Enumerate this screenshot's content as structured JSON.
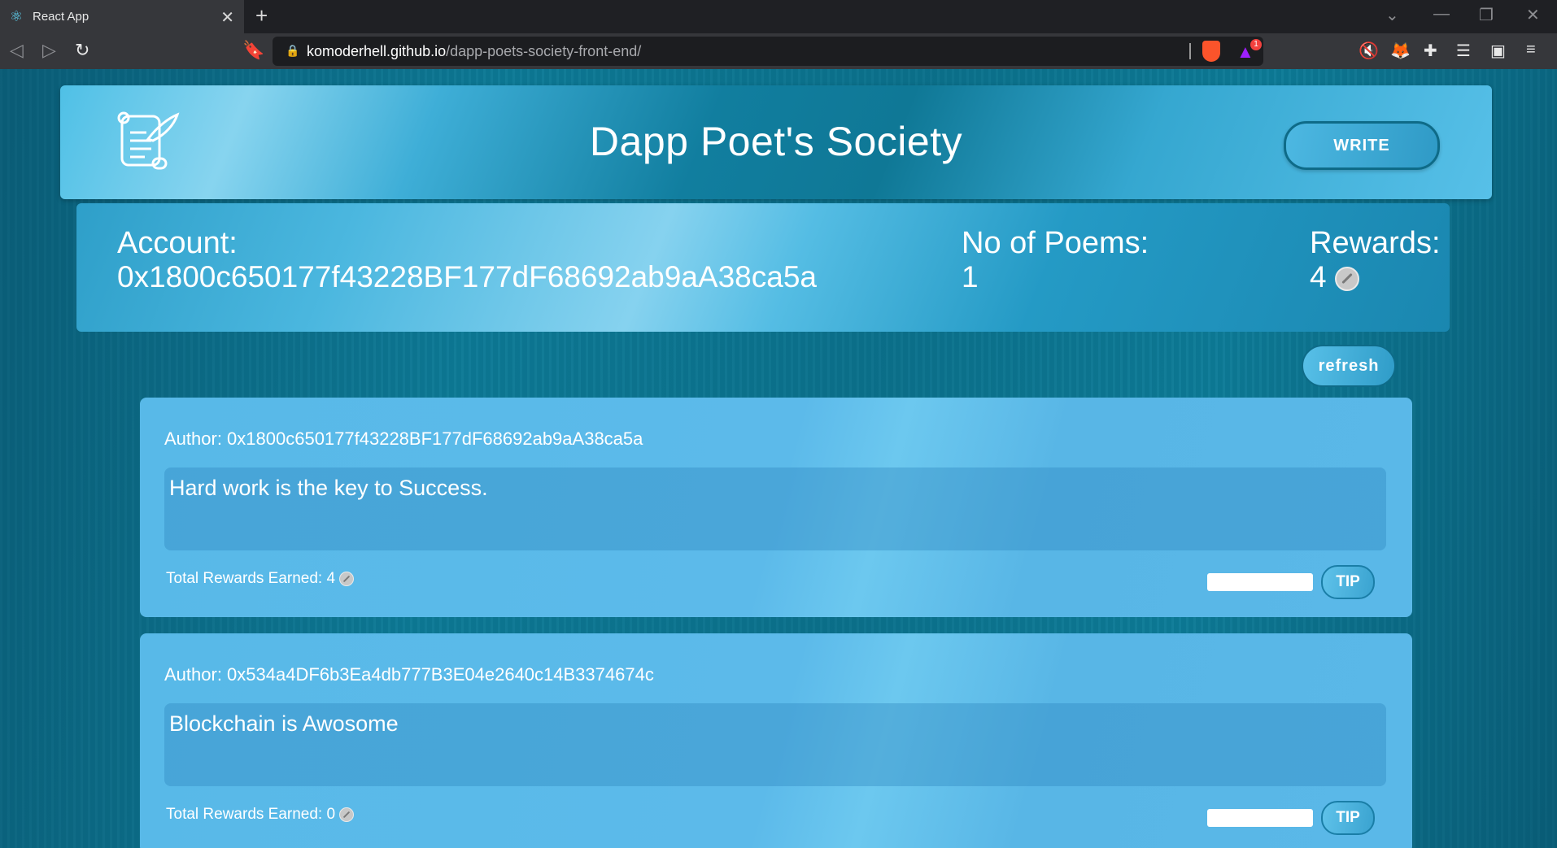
{
  "browser": {
    "tab_title": "React App",
    "tab_close": "✕",
    "new_tab": "+",
    "url_host": "komoderhell.github.io",
    "url_path": "/dapp-poets-society-front-end/",
    "rewards_badge": "1"
  },
  "header": {
    "title": "Dapp Poet's Society",
    "write_label": "WRITE"
  },
  "account": {
    "account_label": "Account:",
    "account_value": "0x1800c650177f43228BF177dF68692ab9aA38ca5a",
    "poems_label": "No of Poems:",
    "poems_value": "1",
    "rewards_label": "Rewards:",
    "rewards_value": "4"
  },
  "refresh_label": "refresh",
  "poems": [
    {
      "author": "Author: 0x1800c650177f43228BF177dF68692ab9aA38ca5a",
      "text": "Hard work is the key to Success.",
      "rewards": "Total Rewards Earned: 4",
      "tip_label": "TIP"
    },
    {
      "author": "Author: 0x534a4DF6b3Ea4db777B3E04e2640c14B3374674c",
      "text": "Blockchain is Awosome",
      "rewards": "Total Rewards Earned: 0",
      "tip_label": "TIP"
    }
  ],
  "colors": {
    "accent": "#4db8e2",
    "background": "#0c7a96",
    "card": "#58b9e8"
  }
}
